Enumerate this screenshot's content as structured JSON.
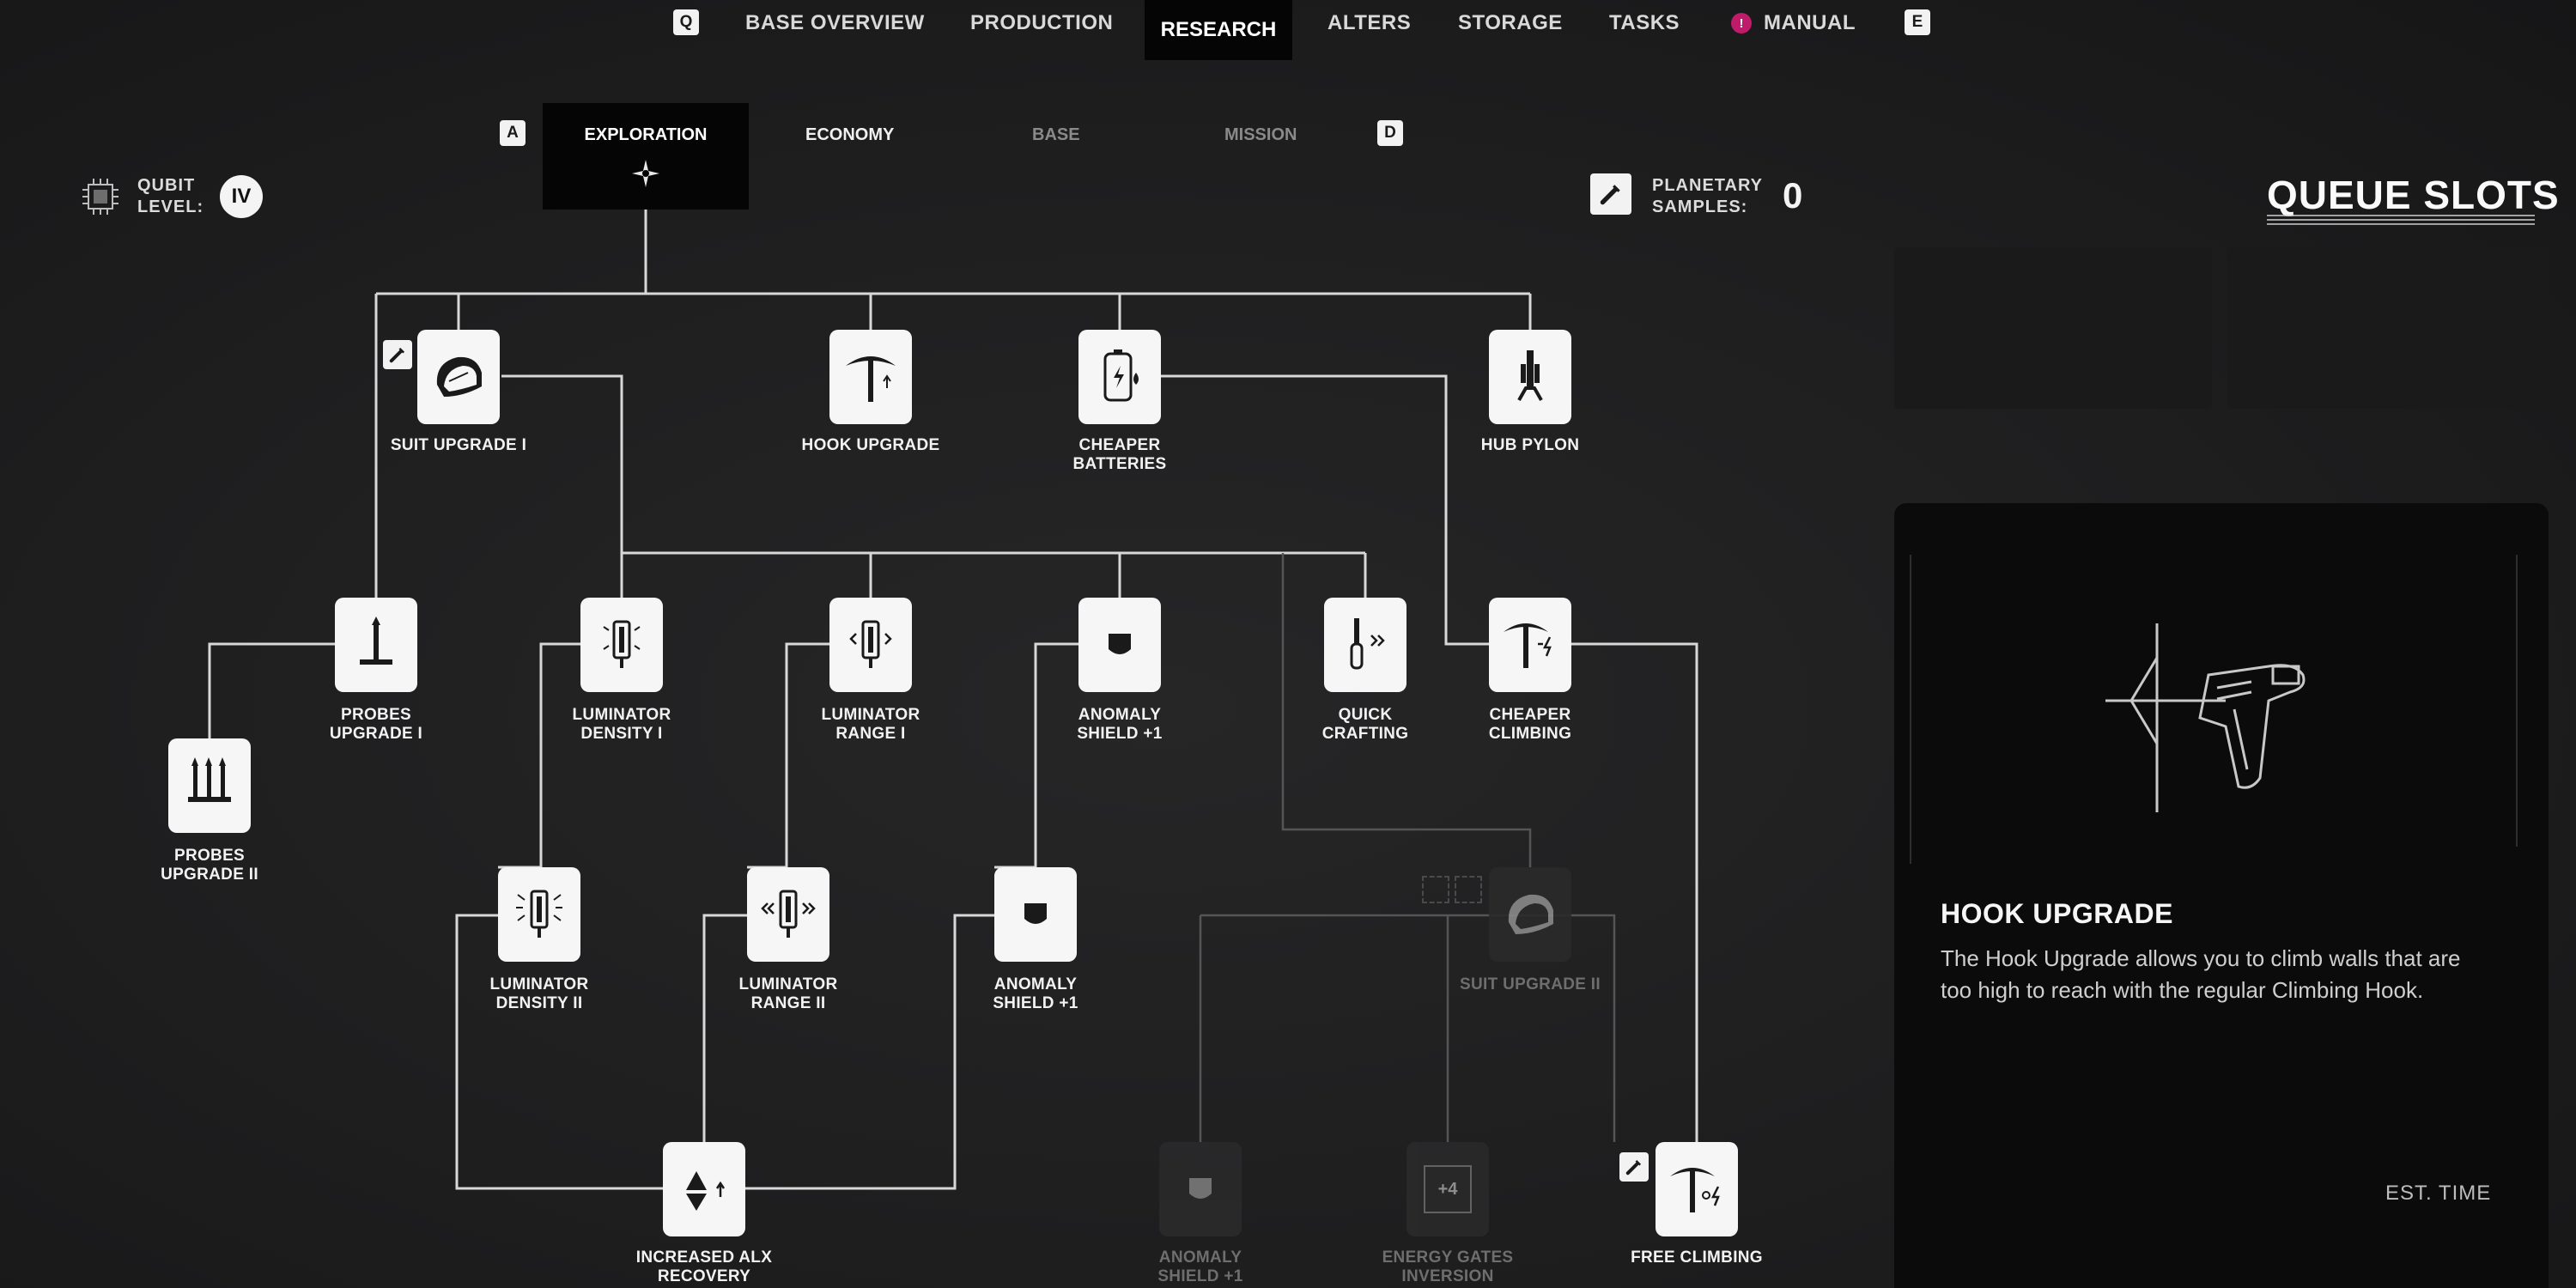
{
  "nav": {
    "key_left": "Q",
    "key_right": "E",
    "items": [
      "BASE OVERVIEW",
      "PRODUCTION",
      "RESEARCH",
      "ALTERS",
      "STORAGE",
      "TASKS"
    ],
    "active": "RESEARCH",
    "manual_badge": "!",
    "manual": "MANUAL"
  },
  "subnav": {
    "key_left": "A",
    "key_right": "D",
    "tabs": [
      "EXPLORATION",
      "ECONOMY",
      "BASE",
      "MISSION"
    ],
    "active": "EXPLORATION"
  },
  "qubit": {
    "label_1": "QUBIT",
    "label_2": "LEVEL:",
    "level": "IV"
  },
  "samples": {
    "label_1": "PLANETARY",
    "label_2": "SAMPLES:",
    "value": "0"
  },
  "queue": {
    "title": "QUEUE SLOTS"
  },
  "nodes": {
    "suit1": "SUIT UPGRADE I",
    "hook": "HOOK UPGRADE",
    "batteries": [
      "CHEAPER",
      "BATTERIES"
    ],
    "pylon": "HUB PYLON",
    "probes1": [
      "PROBES",
      "UPGRADE I"
    ],
    "lumden1": [
      "LUMINATOR",
      "DENSITY I"
    ],
    "lumrange1": [
      "LUMINATOR",
      "RANGE I"
    ],
    "shield1": [
      "ANOMALY",
      "SHIELD +1"
    ],
    "quick": [
      "QUICK",
      "CRAFTING"
    ],
    "climbing": [
      "CHEAPER",
      "CLIMBING"
    ],
    "probes2": [
      "PROBES",
      "UPGRADE II"
    ],
    "lumden2": [
      "LUMINATOR",
      "DENSITY II"
    ],
    "lumrange2": [
      "LUMINATOR",
      "RANGE II"
    ],
    "shield2": [
      "ANOMALY",
      "SHIELD +1"
    ],
    "suit2": "SUIT UPGRADE II",
    "alx": [
      "INCREASED ALX",
      "RECOVERY"
    ],
    "shield3": [
      "ANOMALY",
      "SHIELD +1"
    ],
    "energy": [
      "ENERGY GATES",
      "INVERSION"
    ],
    "free": "FREE CLIMBING",
    "energy_icon_text": "+4"
  },
  "detail": {
    "title": "HOOK UPGRADE",
    "description": "The Hook Upgrade allows you to climb walls that are too high to reach with the regular Climbing Hook.",
    "est_time_label": "EST. TIME"
  },
  "colors": {
    "background": "#1d1d1e",
    "panel": "#0b0b0b",
    "node": "#f6f6f6",
    "manual_badge": "#c01a6a"
  }
}
